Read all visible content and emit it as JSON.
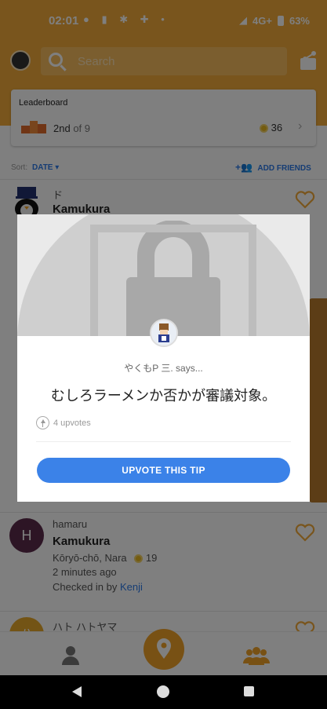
{
  "status_bar": {
    "time": "02:01",
    "notifications": "● ▮ ✱ ✚ •",
    "network": "4G+",
    "battery": "63%"
  },
  "header": {
    "search_placeholder": "Search"
  },
  "leaderboard": {
    "title": "Leaderboard",
    "rank": "2nd",
    "of_total": "of 9",
    "coins": "36"
  },
  "sort": {
    "label": "Sort:",
    "value": "DATE",
    "add_friends": "ADD FRIENDS"
  },
  "feed": [
    {
      "user": "ド",
      "venue": "Kamukura",
      "avatar_color": "#ffffff"
    },
    {
      "user": "hamaru",
      "venue": "Kamukura",
      "location": "Kōryō-chō, Nara",
      "coins": "19",
      "time": "2 minutes ago",
      "checked_in_prefix": "Checked in by",
      "checked_in_friend": "Kenji",
      "avatar_letter": "H",
      "avatar_color": "#5b2a4a"
    },
    {
      "user": "ハト ハトヤマ",
      "avatar_letter": "ハ",
      "avatar_color": "#e7a92b"
    }
  ],
  "tip_modal": {
    "author": "やくもP 三. says...",
    "text": "むしろラーメンか否かが審議対象。",
    "upvotes": "4 upvotes",
    "upvote_button": "UPVOTE THIS TIP"
  },
  "colors": {
    "brand_orange": "#f2ab3a",
    "accent_blue": "#3b82e8",
    "coin_gold": "#e8b821"
  }
}
